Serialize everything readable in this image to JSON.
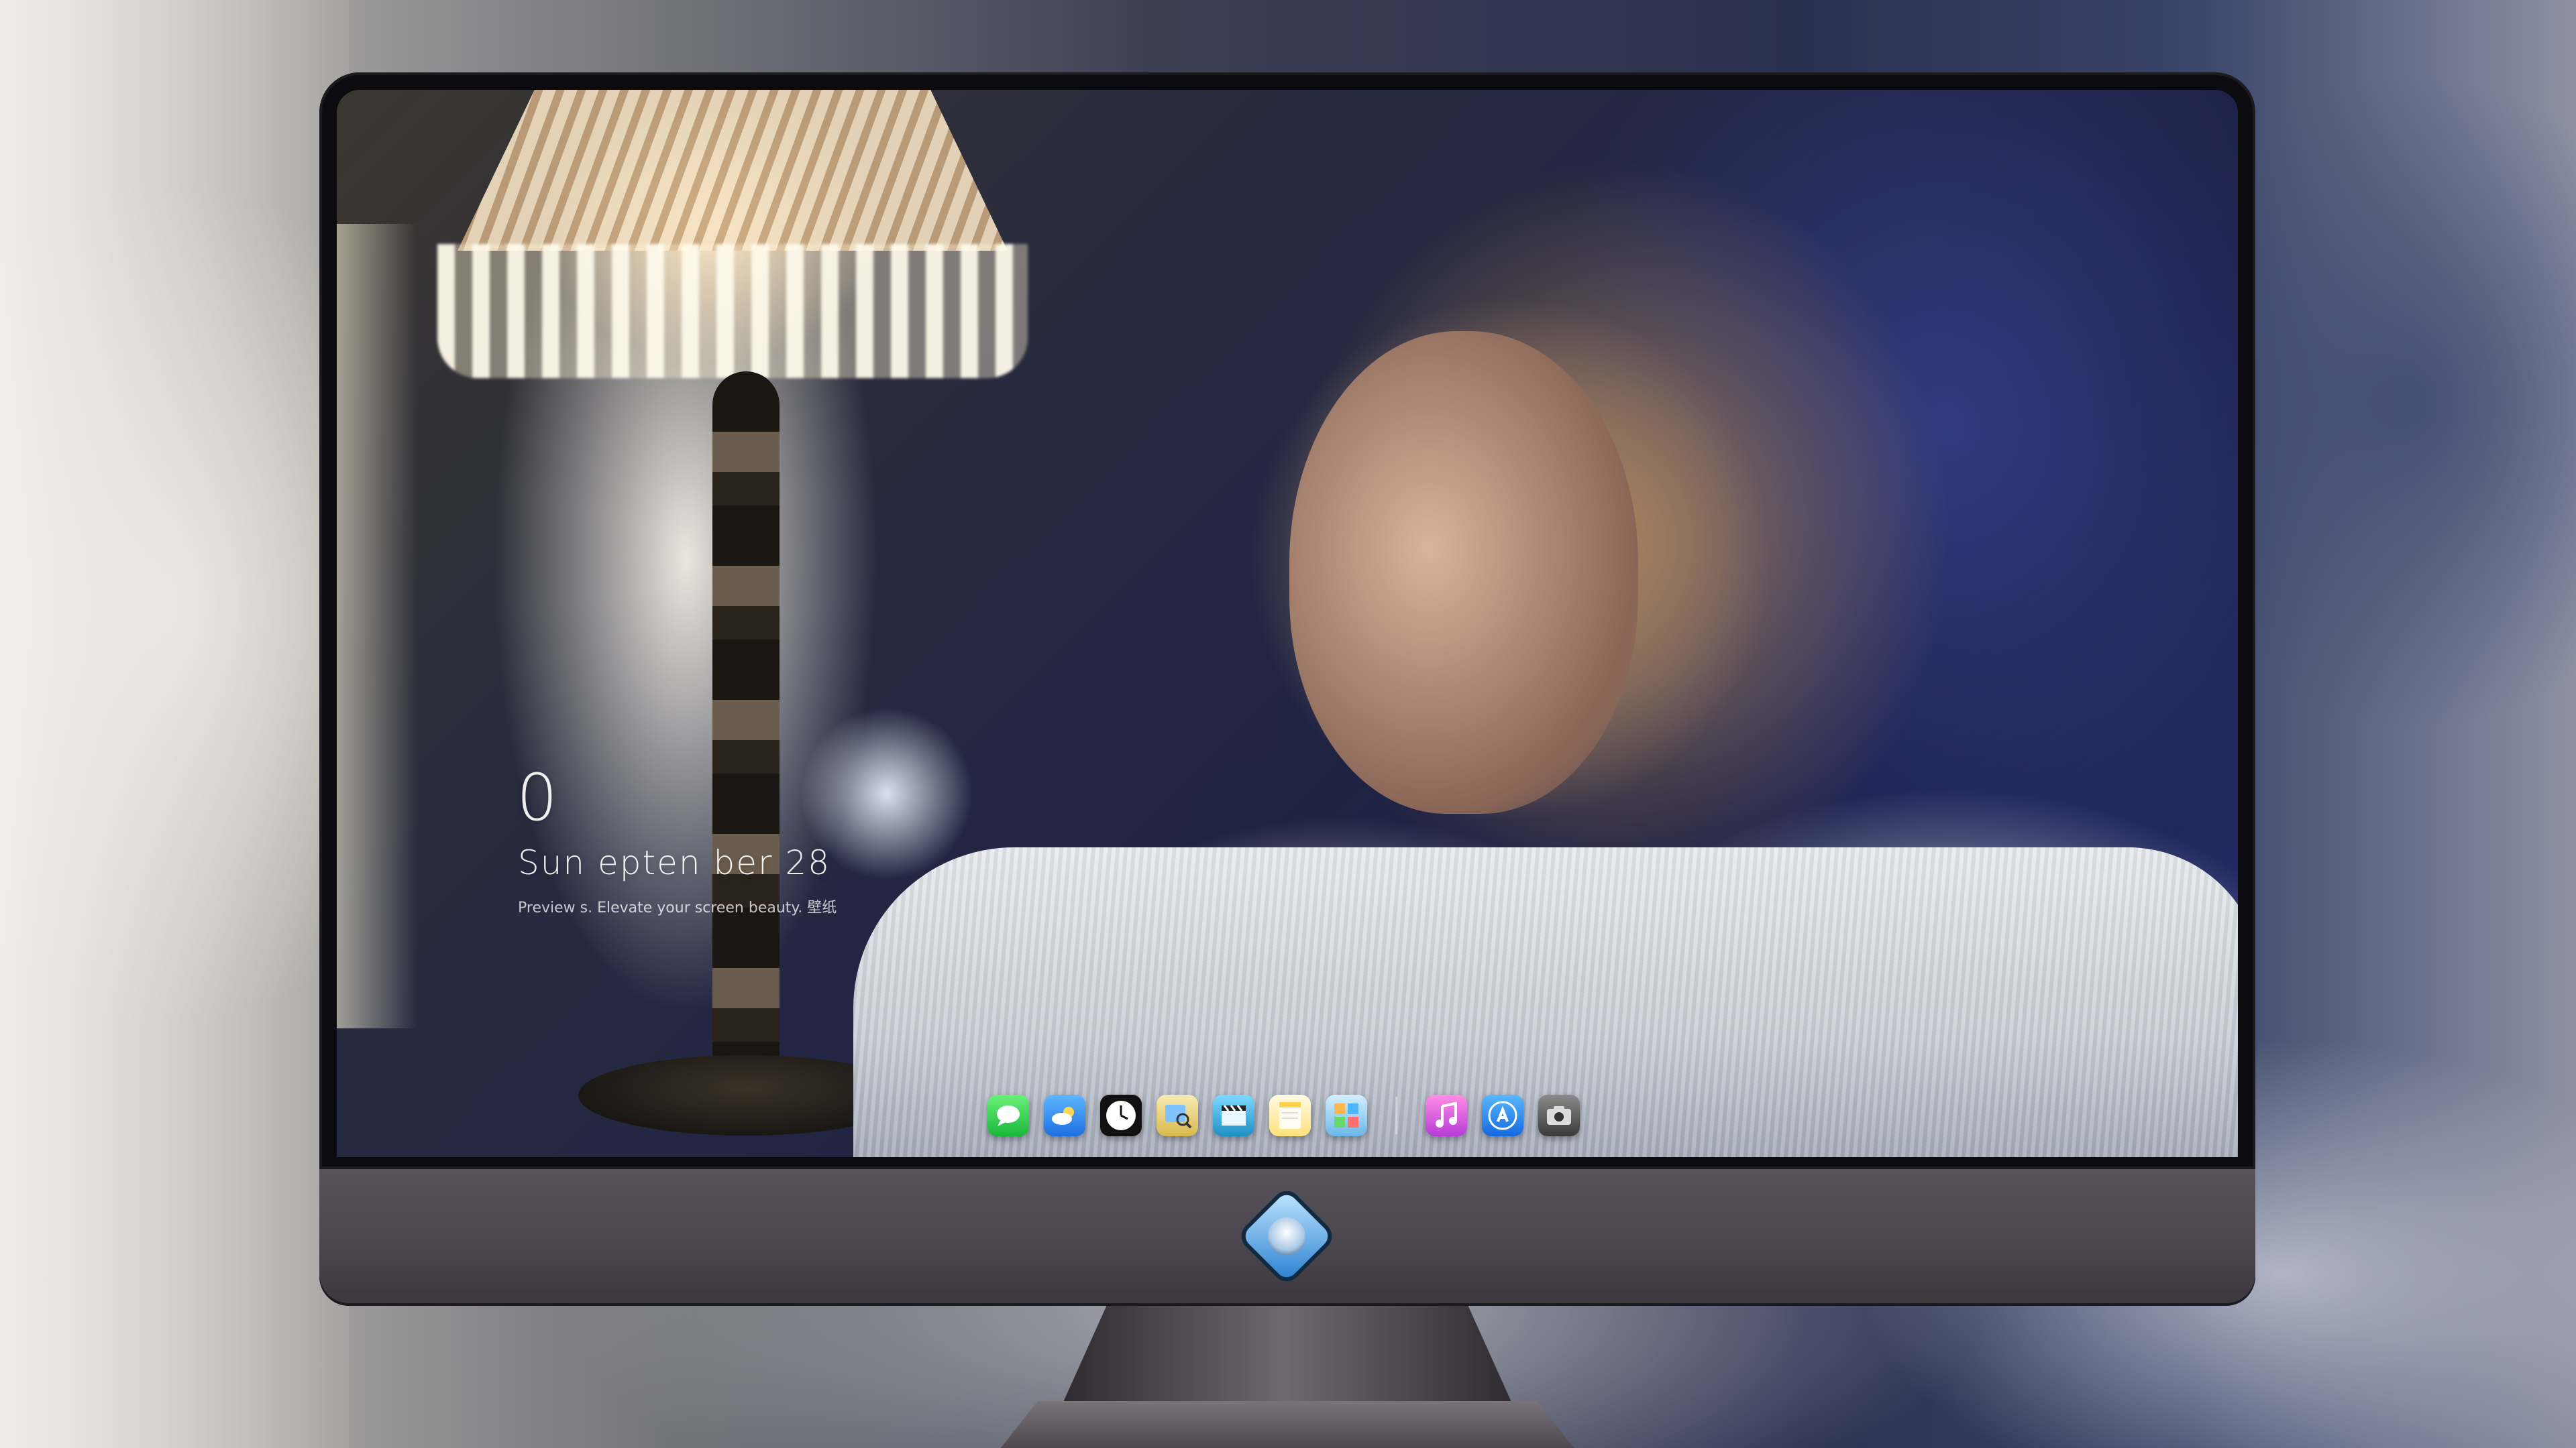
{
  "lock_screen": {
    "time": "0",
    "date": "Sun    epten ber  28",
    "caption": "Preview          s. Elevate your screen beauty. 壁纸"
  },
  "dock": {
    "apps": [
      {
        "name": "messages",
        "icon": "speech-bubble",
        "color": "#2fd24a"
      },
      {
        "name": "weather",
        "icon": "cloud-sun",
        "color": "#2f8cf0"
      },
      {
        "name": "clock",
        "icon": "clock",
        "color": "#111111"
      },
      {
        "name": "preview",
        "icon": "photo-magnifier",
        "color": "#e8d27a"
      },
      {
        "name": "video",
        "icon": "clapperboard",
        "color": "#3aa6d8"
      },
      {
        "name": "notes",
        "icon": "notepad",
        "color": "#ffd84d"
      },
      {
        "name": "photo-booth",
        "icon": "photos-grid",
        "color": "#6ec2f0"
      },
      {
        "name": "itunes",
        "icon": "music-note",
        "color": "#d64bd0"
      },
      {
        "name": "app-store",
        "icon": "app-store-a",
        "color": "#1e90ff"
      },
      {
        "name": "screenshot",
        "icon": "camera",
        "color": "#5e5e5e"
      }
    ]
  },
  "branding": {
    "chin_logo": "mascot-diamond-logo"
  }
}
